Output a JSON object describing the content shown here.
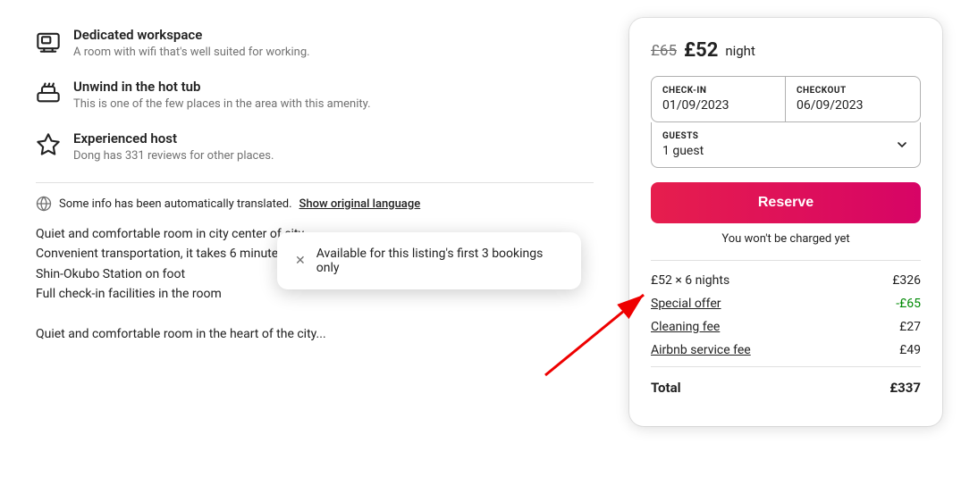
{
  "features": [
    {
      "id": "workspace",
      "title": "Dedicated workspace",
      "description": "A room with wifi that's well suited for working.",
      "icon": "workspace"
    },
    {
      "id": "hot-tub",
      "title": "Unwind in the hot tub",
      "description": "This is one of the few places in the area with this amenity.",
      "icon": "hot-tub"
    },
    {
      "id": "host",
      "title": "Experienced host",
      "description": "Dong has 331 reviews for other places.",
      "icon": "star"
    }
  ],
  "translation": {
    "notice": "Some info has been automatically translated.",
    "link_text": "Show original language"
  },
  "description": "Quiet and comfortable room in city center of city\nConvenient transportation, it takes 6 minutes to Okubo Station on foot, 10 minutes to Shin-Okubo Station on foot\nFull check-in facilities in the room\n\nQuiet and comfortable room in the heart of the city...",
  "booking": {
    "price_original": "£65",
    "price_current": "£52",
    "price_suffix": "night",
    "checkin_label": "CHECK-IN",
    "checkin_value": "01/09/2023",
    "checkout_label": "CHECKOUT",
    "checkout_value": "06/09/2023",
    "guests_label": "GUESTS",
    "guests_value": "1 guest",
    "reserve_label": "Reserve",
    "no_charge": "You won't be charged yet",
    "breakdown": [
      {
        "label": "£52 × 6 nights",
        "amount": "£326",
        "type": "normal",
        "link": false,
        "partial_label": "s",
        "partial_amount": "£326"
      },
      {
        "label": "Special offer",
        "amount": "-£65",
        "type": "special-offer",
        "link": true
      },
      {
        "label": "Cleaning fee",
        "amount": "£27",
        "type": "normal",
        "link": true
      },
      {
        "label": "Airbnb service fee",
        "amount": "£49",
        "type": "normal",
        "link": true
      }
    ],
    "total_label": "Total",
    "total_amount": "£337"
  },
  "tooltip": {
    "close_symbol": "✕",
    "message": "Available for this listing's first 3 bookings only"
  }
}
